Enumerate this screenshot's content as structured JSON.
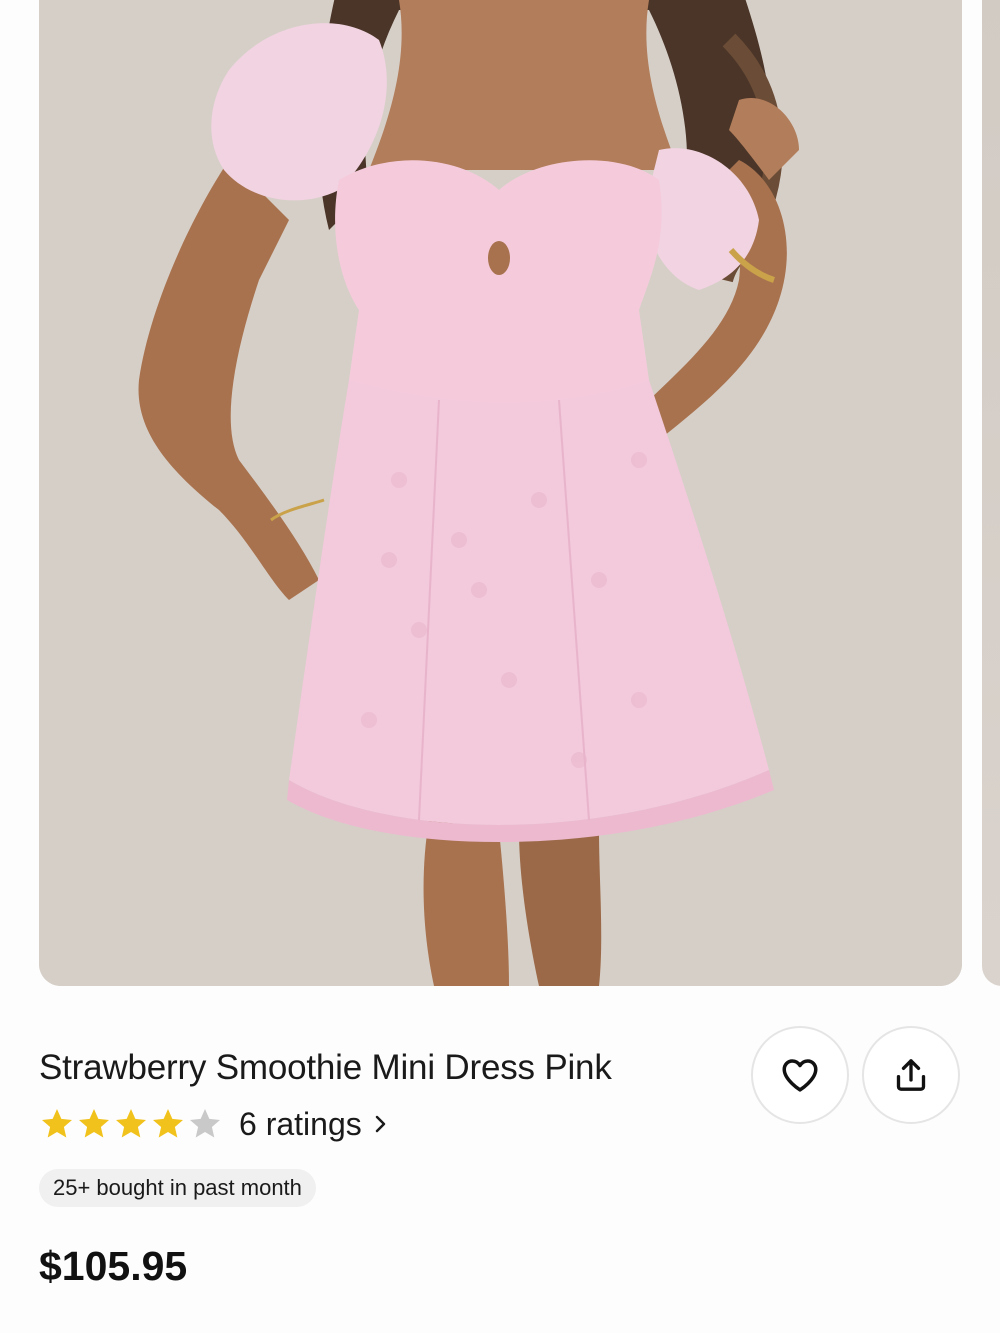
{
  "product": {
    "title": "Strawberry Smoothie Mini Dress Pink",
    "price": "$105.95",
    "image_icon": "product-photo",
    "rating": {
      "value": 4,
      "max": 5,
      "count_label": "6 ratings"
    },
    "social_proof": "25+ bought in past month"
  },
  "actions": {
    "favorite_icon": "heart-outline-icon",
    "share_icon": "share-upload-icon"
  },
  "colors": {
    "star_filled": "#f1c21b",
    "star_empty": "#c9c9c9",
    "dress_pink": "#f3c9dc",
    "badge_bg": "#f0f0f0"
  }
}
